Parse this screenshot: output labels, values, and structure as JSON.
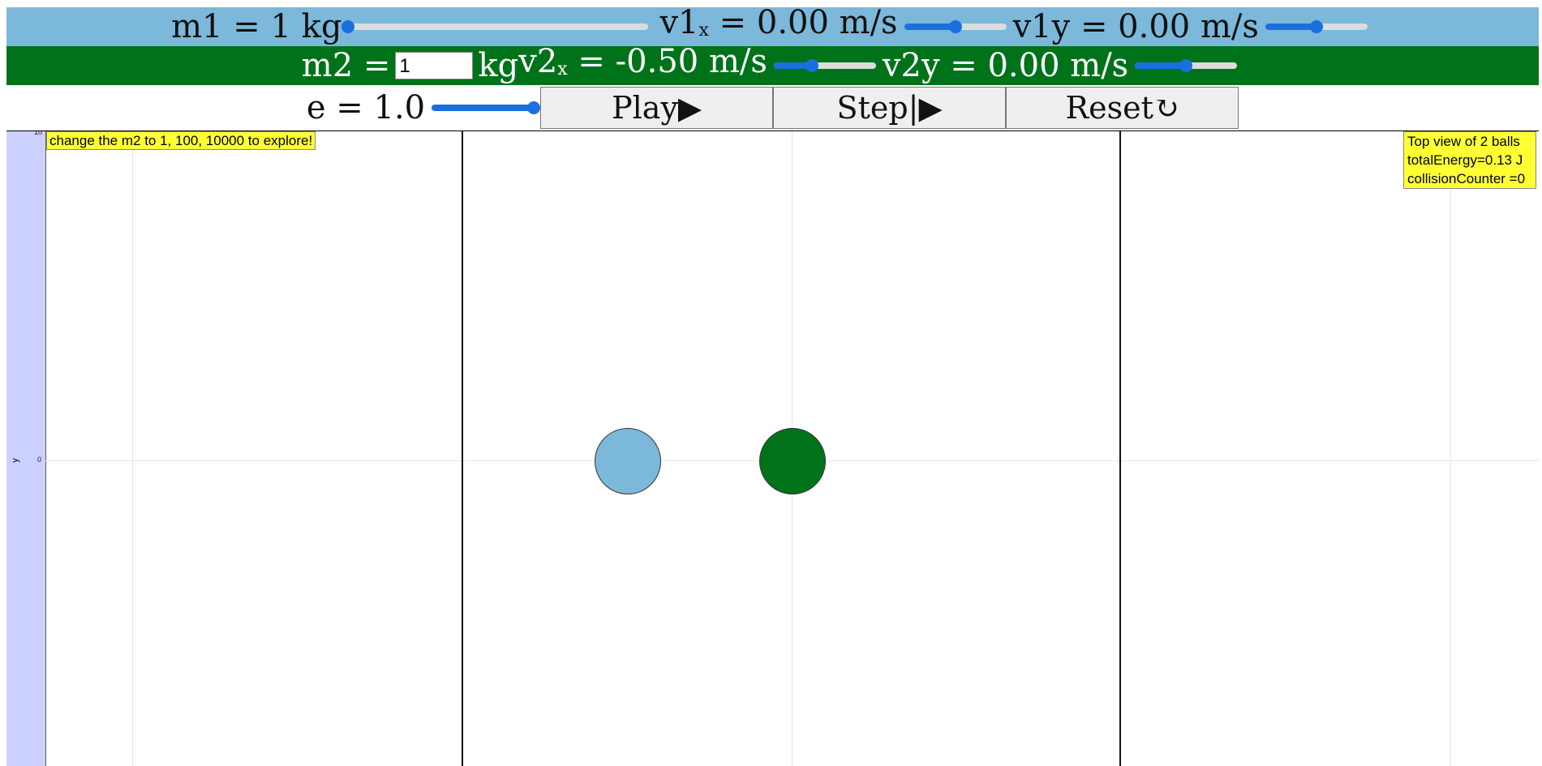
{
  "controls": {
    "m1": {
      "prefix": "m1 = ",
      "value": "1",
      "unit": " kg",
      "slider_fraction": 0.0
    },
    "v1x": {
      "prefix": "v1",
      "sub": "x",
      "suffix": " = 0.00 m/s",
      "slider_fraction": 0.5
    },
    "v1y": {
      "text": "v1y = 0.00 m/s",
      "slider_fraction": 0.5
    },
    "m2": {
      "prefix": "m2 = ",
      "value": "1",
      "unit": "kg"
    },
    "v2x": {
      "prefix": " v2",
      "sub": "x",
      "suffix": " = -0.50 m/s",
      "slider_fraction": 0.375
    },
    "v2y": {
      "text": "v2y = 0.00 m/s",
      "slider_fraction": 0.5
    },
    "e": {
      "text": "e = 1.0",
      "slider_fraction": 1.0
    }
  },
  "buttons": {
    "play": "Play▶",
    "step": "Step|▶",
    "reset": "Reset↻"
  },
  "canvas": {
    "y_axis_label": "y",
    "y_ticks": [
      "10",
      "0"
    ],
    "hint": "change the m2 to 1, 100, 10000 to explore!",
    "info_lines": [
      "Top view of 2 balls",
      "totalEnergy=0.13 J",
      "collisionCounter =0"
    ]
  },
  "colors": {
    "row1_bg": "#7bb8da",
    "row2_bg": "#00731a",
    "ball1": "#7bb8da",
    "ball2": "#00731a",
    "slider_accent": "#1a6fe0",
    "note_bg": "#ffff33"
  }
}
